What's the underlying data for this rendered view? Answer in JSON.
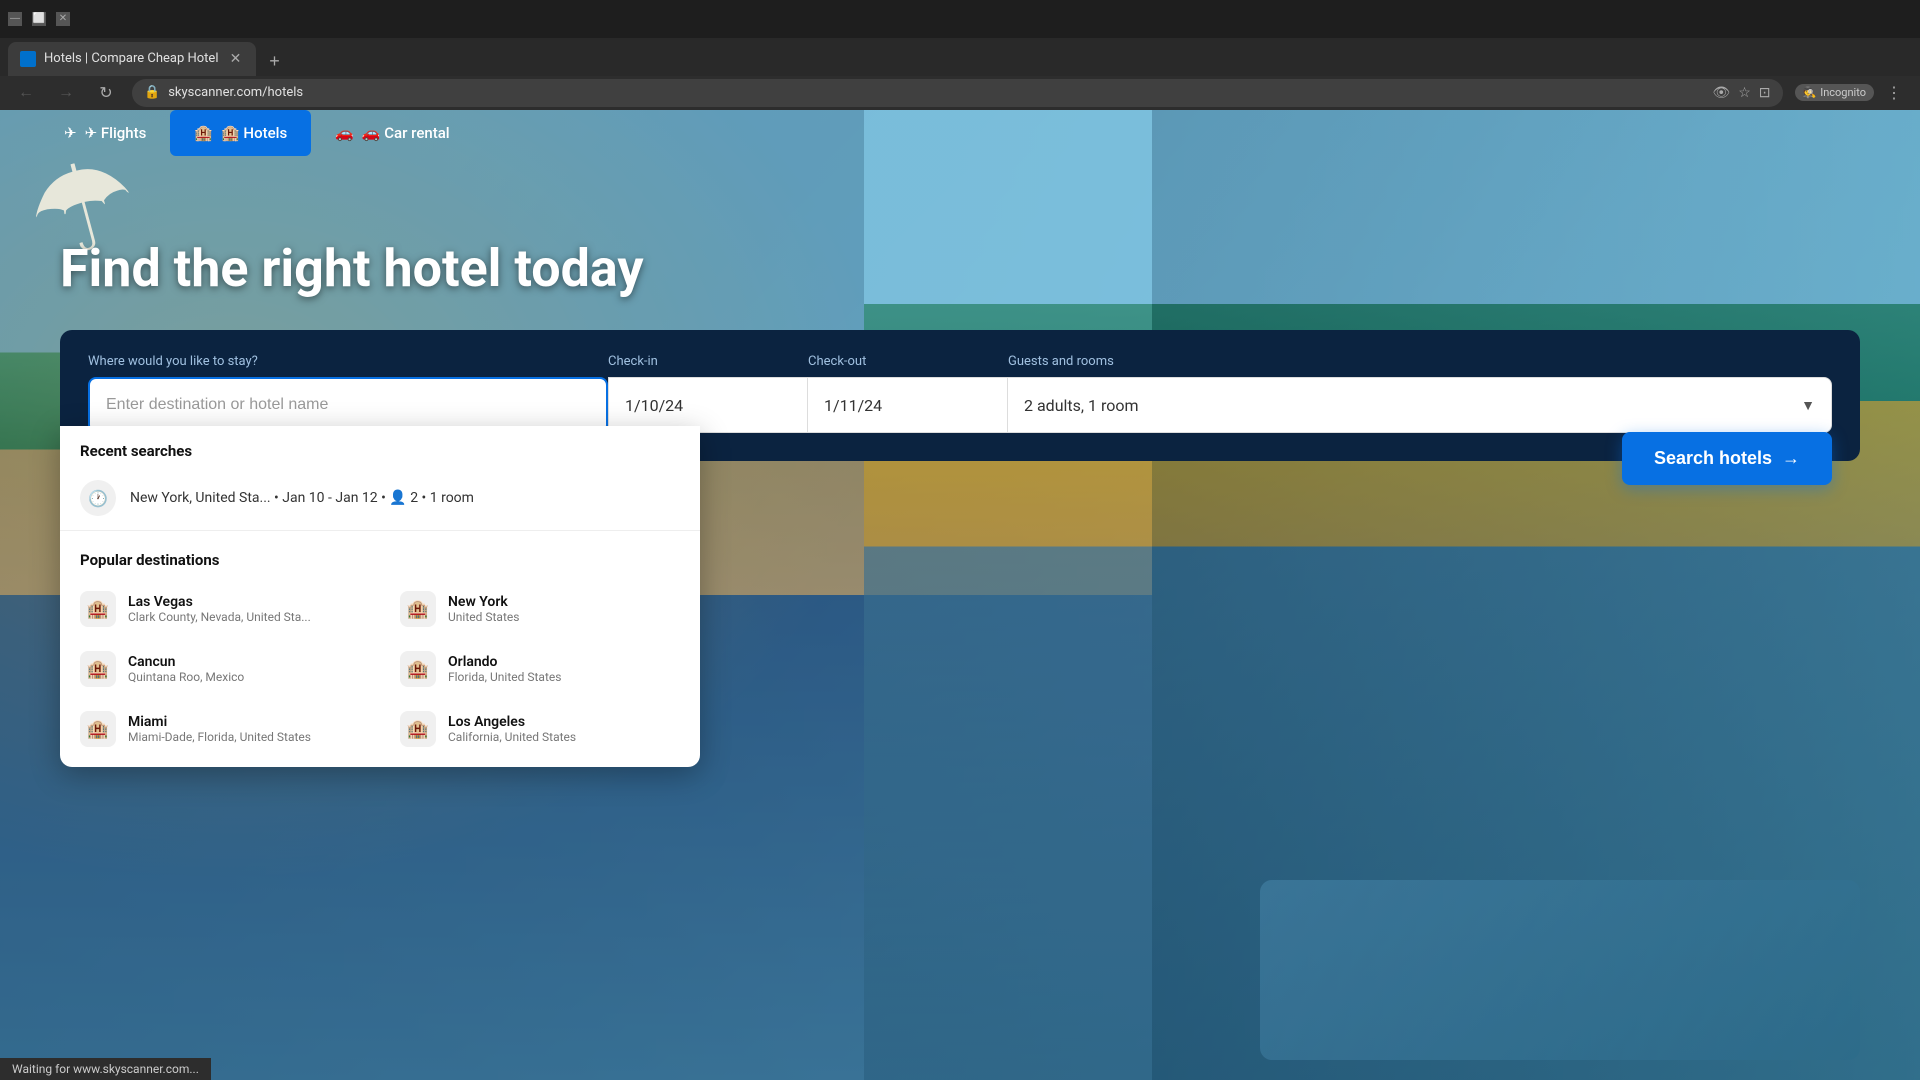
{
  "browser": {
    "tab_title": "Hotels | Compare Cheap Hotel",
    "url": "skyscanner.com/hotels",
    "new_tab_label": "+",
    "incognito_label": "Incognito",
    "nav": {
      "back_icon": "←",
      "forward_icon": "→",
      "refresh_icon": "↻",
      "close_icon": "✕",
      "bookmark_icon": "☆",
      "profile_icon": "⊡",
      "menu_icon": "⋮",
      "eye_off_icon": "👁"
    }
  },
  "site_nav": {
    "tabs": [
      {
        "id": "flights",
        "label": "✈ Flights",
        "active": false
      },
      {
        "id": "hotels",
        "label": "🏨 Hotels",
        "active": true
      },
      {
        "id": "car_rental",
        "label": "🚗 Car rental",
        "active": false
      }
    ]
  },
  "hero": {
    "title": "Find the right hotel today"
  },
  "search": {
    "destination_label": "Where would you like to stay?",
    "destination_placeholder": "Enter destination or hotel name",
    "checkin_label": "Check-in",
    "checkin_value": "1/10/24",
    "checkout_label": "Check-out",
    "checkout_value": "1/11/24",
    "guests_label": "Guests and rooms",
    "guests_value": "2 adults, 1 room",
    "search_button_label": "Search hotels",
    "search_button_arrow": "→"
  },
  "dropdown": {
    "recent_title": "Recent searches",
    "recent_items": [
      {
        "icon": "🕐",
        "text": "New York, United Sta... • Jan 10 - Jan 12 • 👤 2 • 1 room"
      }
    ],
    "popular_title": "Popular destinations",
    "popular_items": [
      {
        "name": "Las Vegas",
        "sub": "Clark County, Nevada, United Sta...",
        "icon": "🏨"
      },
      {
        "name": "New York",
        "sub": "United States",
        "icon": "🏨"
      },
      {
        "name": "Cancun",
        "sub": "Quintana Roo, Mexico",
        "icon": "🏨"
      },
      {
        "name": "Orlando",
        "sub": "Florida, United States",
        "icon": "🏨"
      },
      {
        "name": "Miami",
        "sub": "Miami-Dade, Florida, United States",
        "icon": "🏨"
      },
      {
        "name": "Los Angeles",
        "sub": "California, United States",
        "icon": "🏨"
      }
    ]
  },
  "status_bar": {
    "text": "Waiting for www.skyscanner.com..."
  }
}
